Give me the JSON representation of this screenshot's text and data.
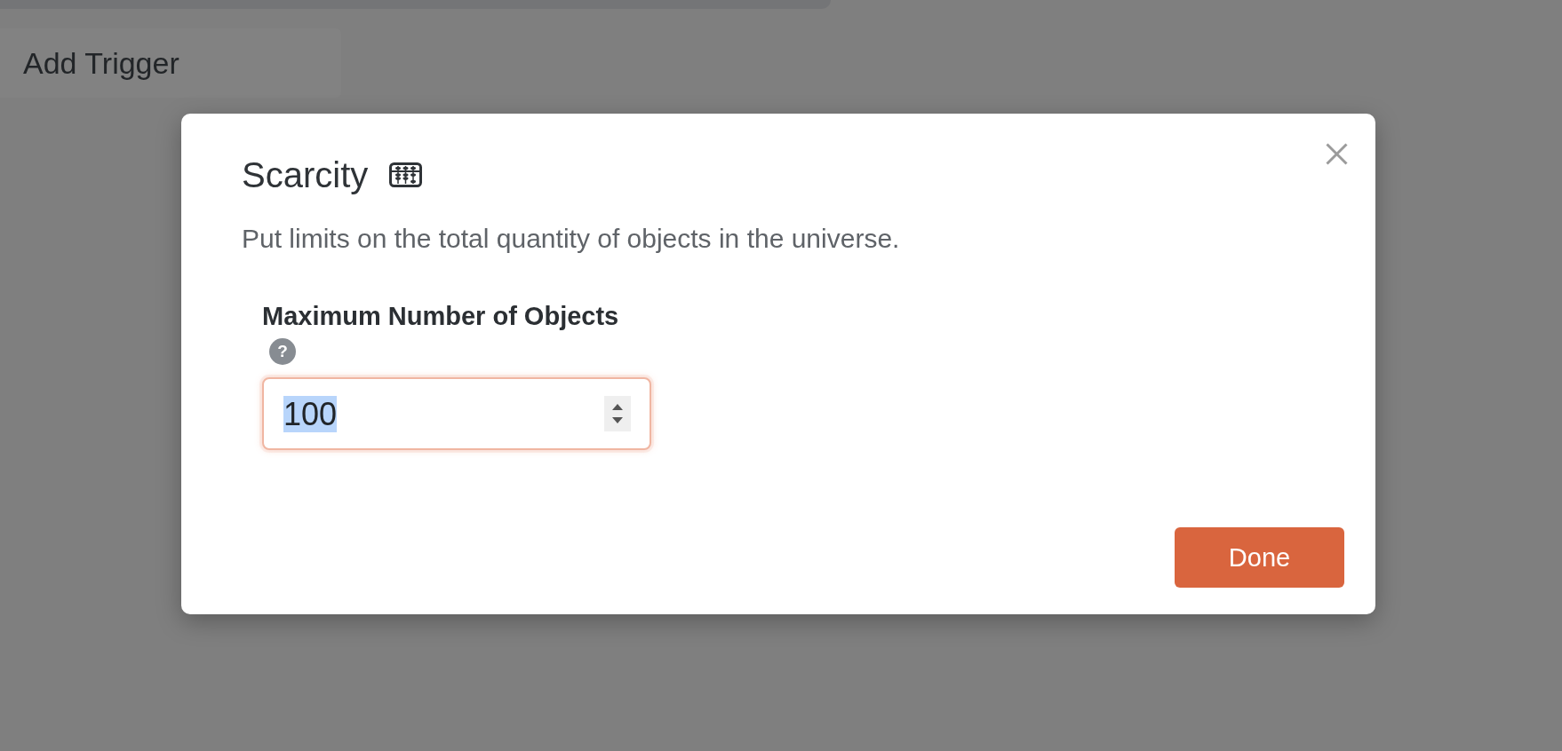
{
  "background": {
    "add_trigger_button": {
      "label": "Add Trigger"
    }
  },
  "dialog": {
    "title": "Scarcity",
    "description": "Put limits on the total quantity of objects in the universe.",
    "field": {
      "label": "Maximum Number of Objects",
      "help": "?",
      "value": "100",
      "focused": true,
      "value_selected": true
    },
    "buttons": [
      {
        "label": "Done",
        "kind": "primary"
      }
    ]
  }
}
